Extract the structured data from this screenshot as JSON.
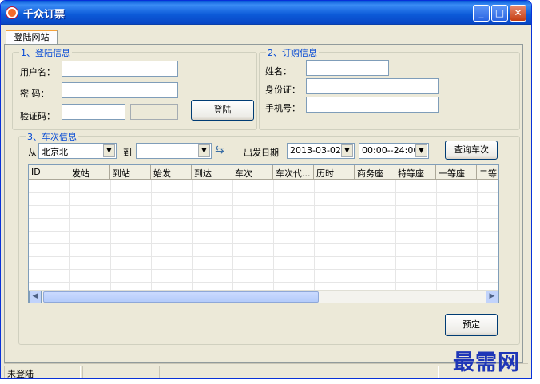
{
  "window": {
    "title": "千众订票",
    "minimize": "_",
    "maximize": "□",
    "close": "✕"
  },
  "tab": {
    "label": "登陆网站"
  },
  "login": {
    "group_title": "1、登陆信息",
    "username_label": "用户名：",
    "username_value": "",
    "password_label": "密  码：",
    "password_value": "",
    "captcha_label": "验证码：",
    "captcha_value": "",
    "login_button": "登陆"
  },
  "order": {
    "group_title": "2、订购信息",
    "name_label": "姓名：",
    "name_value": "",
    "id_label": "身份证：",
    "id_value": "",
    "phone_label": "手机号：",
    "phone_value": ""
  },
  "train": {
    "group_title": "3、车次信息",
    "from_label": "从",
    "from_value": "北京北",
    "to_label": "到",
    "to_value": "",
    "date_label": "出发日期",
    "date_value": "2013-03-02",
    "time_value": "00:00--24:00",
    "query_button": "查询车次",
    "columns": [
      "ID",
      "发站",
      "到站",
      "始发",
      "到达",
      "车次",
      "车次代...",
      "历时",
      "商务座",
      "特等座",
      "一等座",
      "二等"
    ],
    "book_button": "预定"
  },
  "status": {
    "text": "未登陆"
  },
  "watermark": "最需网"
}
